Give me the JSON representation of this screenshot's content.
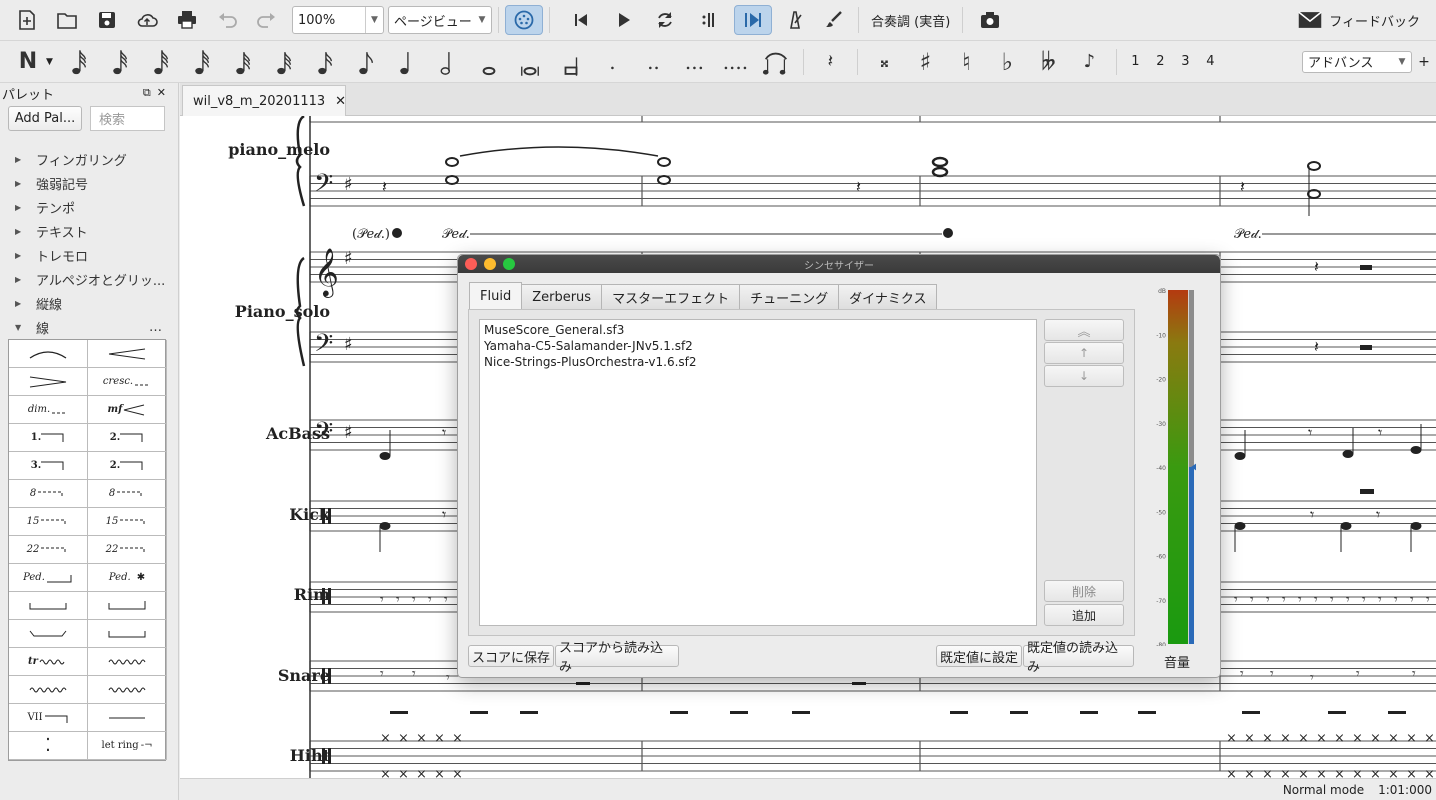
{
  "toolbar": {
    "zoom_value": "100%",
    "view_mode": "ページビュー",
    "concert_pitch": "合奏調 (実音)",
    "feedback": "フィードバック",
    "workspace": "アドバンス",
    "voices": [
      "1",
      "2",
      "3",
      "4"
    ]
  },
  "palette": {
    "title": "パレット",
    "add_button": "Add Pal...",
    "search_placeholder": "検索",
    "categories": [
      {
        "label": "フィンガリング",
        "expanded": false
      },
      {
        "label": "強弱記号",
        "expanded": false
      },
      {
        "label": "テンポ",
        "expanded": false
      },
      {
        "label": "テキスト",
        "expanded": false
      },
      {
        "label": "トレモロ",
        "expanded": false
      },
      {
        "label": "アルペジオとグリッ...",
        "expanded": false
      },
      {
        "label": "縦線",
        "expanded": false
      },
      {
        "label": "線",
        "expanded": true
      }
    ],
    "lines_cells": [
      "",
      "",
      "",
      "cresc.",
      "dim.",
      "mf",
      "1.",
      "2.",
      "3.",
      "2.",
      "8",
      "8",
      "15",
      "15",
      "22",
      "22",
      "Ped.",
      "Ped.",
      "",
      "",
      "",
      "",
      "tr",
      "",
      "",
      "",
      "VII",
      "",
      "",
      "let ring"
    ]
  },
  "score": {
    "tab_name": "wil_v8_m_20201113",
    "instruments": [
      {
        "name": "piano_melo"
      },
      {
        "name": "Piano_solo"
      },
      {
        "name": "AcBass"
      },
      {
        "name": "Kick"
      },
      {
        "name": "Rim"
      },
      {
        "name": "Snare"
      },
      {
        "name": "Hiht"
      }
    ]
  },
  "status": {
    "mode": "Normal mode",
    "position": "1:01:000"
  },
  "synth": {
    "title": "シンセサイザー",
    "tabs": [
      "Fluid",
      "Zerberus",
      "マスターエフェクト",
      "チューニング",
      "ダイナミクス"
    ],
    "soundfonts": [
      "MuseScore_General.sf3",
      "Yamaha-C5-Salamander-JNv5.1.sf2",
      "Nice-Strings-PlusOrchestra-v1.6.sf2"
    ],
    "side_buttons": {
      "delete": "削除",
      "add": "追加"
    },
    "bottom_buttons": {
      "save_to_score": "スコアに保存",
      "load_from_score": "スコアから読み込み",
      "set_default": "既定値に設定",
      "load_default": "既定値の読み込み"
    },
    "volume_label": "音量",
    "meter_ticks": [
      "dB",
      "-10",
      "-20",
      "-30",
      "-40",
      "-50",
      "-60",
      "-70",
      "-80"
    ],
    "volume_db": -40
  }
}
